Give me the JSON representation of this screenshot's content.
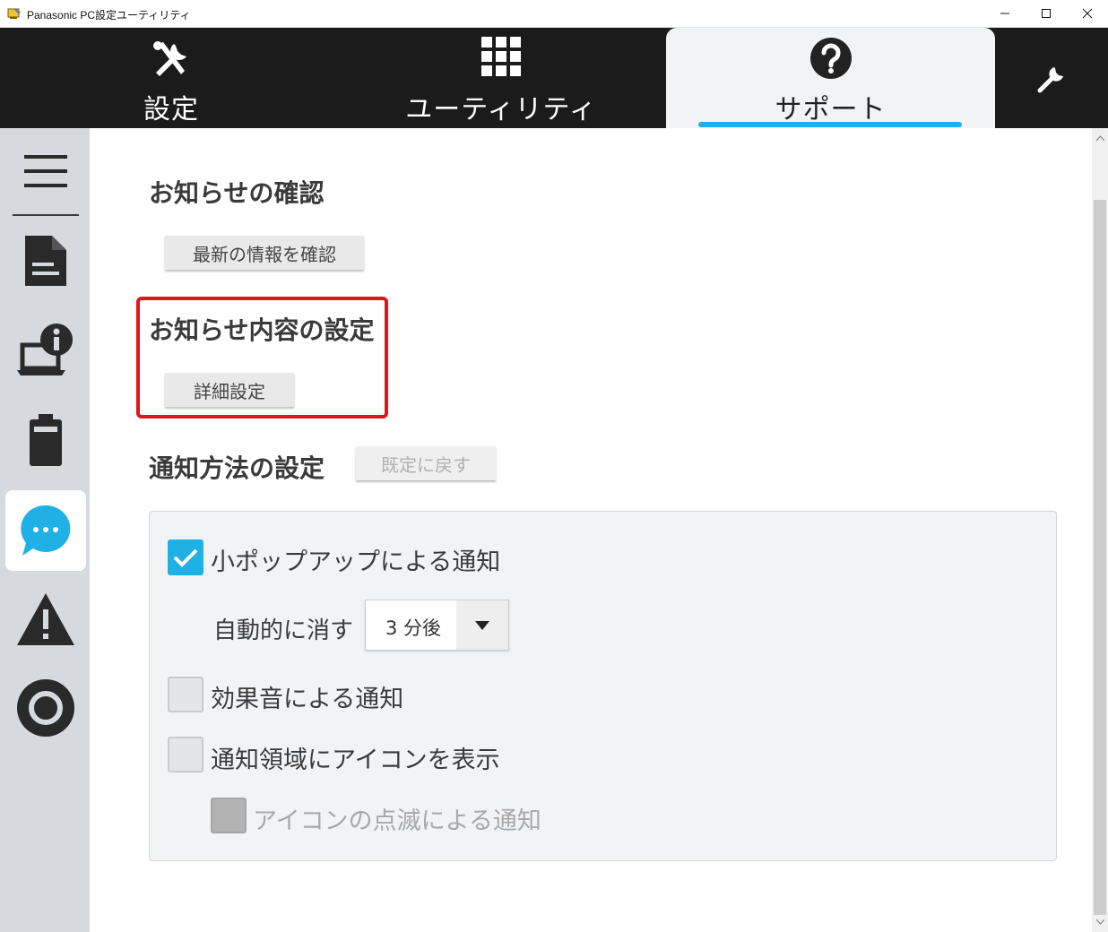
{
  "window": {
    "title": "Panasonic PC設定ユーティリティ",
    "minimize_glyph": "—",
    "maximize_glyph": "☐",
    "close_glyph": "✕"
  },
  "topnav": {
    "tabs": [
      {
        "label": "設定",
        "icon": "tools-icon"
      },
      {
        "label": "ユーティリティ",
        "icon": "grid-icon"
      },
      {
        "label": "サポート",
        "icon": "help-icon",
        "selected": true
      }
    ],
    "right_icon": "wrench-icon",
    "accent_color": "#1fb1e6"
  },
  "sidebar": {
    "items": [
      {
        "icon": "menu-icon"
      },
      {
        "icon": "document-icon"
      },
      {
        "icon": "pc-info-icon"
      },
      {
        "icon": "battery-icon"
      },
      {
        "icon": "chat-bubble-icon",
        "selected": true
      },
      {
        "icon": "warning-icon"
      },
      {
        "icon": "target-icon"
      }
    ]
  },
  "main": {
    "news_check": {
      "heading": "お知らせの確認",
      "button": "最新の情報を確認"
    },
    "news_content": {
      "heading": "お知らせ内容の設定",
      "button": "詳細設定"
    },
    "notify_method": {
      "heading": "通知方法の設定",
      "reset_button": "既定に戻す",
      "options": {
        "popup": {
          "label": "小ポップアップによる通知",
          "checked": true
        },
        "auto_dismiss_label": "自動的に消す",
        "auto_dismiss_value": "3 分後",
        "sound": {
          "label": "効果音による通知",
          "checked": false
        },
        "tray_icon": {
          "label": "通知領域にアイコンを表示",
          "checked": false
        },
        "blink": {
          "label": "アイコンの点滅による通知",
          "checked": false,
          "disabled": true
        }
      }
    }
  }
}
